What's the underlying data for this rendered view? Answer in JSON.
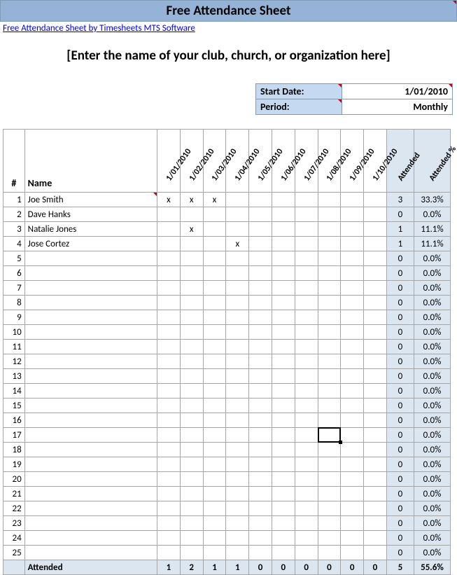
{
  "title": "Free Attendance Sheet",
  "linktext": "Free Attendance Sheet by Timesheets MTS Software",
  "organization": "[Enter the name of your club, church, or organization here]",
  "config": {
    "start_label": "Start Date:",
    "start_value": "1/01/2010",
    "period_label": "Period:",
    "period_value": "Monthly"
  },
  "headers": {
    "num": "#",
    "name": "Name",
    "dates": [
      "1/01/2010",
      "1/02/2010",
      "1/03/2010",
      "1/04/2010",
      "1/05/2010",
      "1/06/2010",
      "1/07/2010",
      "1/08/2010",
      "1/09/2010",
      "1/10/2010"
    ],
    "attended": "Attended",
    "attended_pct": "Attended %"
  },
  "rows": [
    {
      "num": 1,
      "name": "Joe Smith",
      "marks": [
        "x",
        "x",
        "x",
        "",
        "",
        "",
        "",
        "",
        "",
        ""
      ],
      "att": 3,
      "pct": "33.3%"
    },
    {
      "num": 2,
      "name": "Dave Hanks",
      "marks": [
        "",
        "",
        "",
        "",
        "",
        "",
        "",
        "",
        "",
        ""
      ],
      "att": 0,
      "pct": "0.0%"
    },
    {
      "num": 3,
      "name": "Natalie Jones",
      "marks": [
        "",
        "x",
        "",
        "",
        "",
        "",
        "",
        "",
        "",
        ""
      ],
      "att": 1,
      "pct": "11.1%"
    },
    {
      "num": 4,
      "name": "Jose Cortez",
      "marks": [
        "",
        "",
        "",
        "x",
        "",
        "",
        "",
        "",
        "",
        ""
      ],
      "att": 1,
      "pct": "11.1%"
    },
    {
      "num": 5,
      "name": "",
      "marks": [
        "",
        "",
        "",
        "",
        "",
        "",
        "",
        "",
        "",
        ""
      ],
      "att": 0,
      "pct": "0.0%"
    },
    {
      "num": 6,
      "name": "",
      "marks": [
        "",
        "",
        "",
        "",
        "",
        "",
        "",
        "",
        "",
        ""
      ],
      "att": 0,
      "pct": "0.0%"
    },
    {
      "num": 7,
      "name": "",
      "marks": [
        "",
        "",
        "",
        "",
        "",
        "",
        "",
        "",
        "",
        ""
      ],
      "att": 0,
      "pct": "0.0%"
    },
    {
      "num": 8,
      "name": "",
      "marks": [
        "",
        "",
        "",
        "",
        "",
        "",
        "",
        "",
        "",
        ""
      ],
      "att": 0,
      "pct": "0.0%"
    },
    {
      "num": 9,
      "name": "",
      "marks": [
        "",
        "",
        "",
        "",
        "",
        "",
        "",
        "",
        "",
        ""
      ],
      "att": 0,
      "pct": "0.0%"
    },
    {
      "num": 10,
      "name": "",
      "marks": [
        "",
        "",
        "",
        "",
        "",
        "",
        "",
        "",
        "",
        ""
      ],
      "att": 0,
      "pct": "0.0%"
    },
    {
      "num": 11,
      "name": "",
      "marks": [
        "",
        "",
        "",
        "",
        "",
        "",
        "",
        "",
        "",
        ""
      ],
      "att": 0,
      "pct": "0.0%"
    },
    {
      "num": 12,
      "name": "",
      "marks": [
        "",
        "",
        "",
        "",
        "",
        "",
        "",
        "",
        "",
        ""
      ],
      "att": 0,
      "pct": "0.0%"
    },
    {
      "num": 13,
      "name": "",
      "marks": [
        "",
        "",
        "",
        "",
        "",
        "",
        "",
        "",
        "",
        ""
      ],
      "att": 0,
      "pct": "0.0%"
    },
    {
      "num": 14,
      "name": "",
      "marks": [
        "",
        "",
        "",
        "",
        "",
        "",
        "",
        "",
        "",
        ""
      ],
      "att": 0,
      "pct": "0.0%"
    },
    {
      "num": 15,
      "name": "",
      "marks": [
        "",
        "",
        "",
        "",
        "",
        "",
        "",
        "",
        "",
        ""
      ],
      "att": 0,
      "pct": "0.0%"
    },
    {
      "num": 16,
      "name": "",
      "marks": [
        "",
        "",
        "",
        "",
        "",
        "",
        "",
        "",
        "",
        ""
      ],
      "att": 0,
      "pct": "0.0%"
    },
    {
      "num": 17,
      "name": "",
      "marks": [
        "",
        "",
        "",
        "",
        "",
        "",
        "",
        "",
        "",
        ""
      ],
      "att": 0,
      "pct": "0.0%"
    },
    {
      "num": 18,
      "name": "",
      "marks": [
        "",
        "",
        "",
        "",
        "",
        "",
        "",
        "",
        "",
        ""
      ],
      "att": 0,
      "pct": "0.0%"
    },
    {
      "num": 19,
      "name": "",
      "marks": [
        "",
        "",
        "",
        "",
        "",
        "",
        "",
        "",
        "",
        ""
      ],
      "att": 0,
      "pct": "0.0%"
    },
    {
      "num": 20,
      "name": "",
      "marks": [
        "",
        "",
        "",
        "",
        "",
        "",
        "",
        "",
        "",
        ""
      ],
      "att": 0,
      "pct": "0.0%"
    },
    {
      "num": 21,
      "name": "",
      "marks": [
        "",
        "",
        "",
        "",
        "",
        "",
        "",
        "",
        "",
        ""
      ],
      "att": 0,
      "pct": "0.0%"
    },
    {
      "num": 22,
      "name": "",
      "marks": [
        "",
        "",
        "",
        "",
        "",
        "",
        "",
        "",
        "",
        ""
      ],
      "att": 0,
      "pct": "0.0%"
    },
    {
      "num": 23,
      "name": "",
      "marks": [
        "",
        "",
        "",
        "",
        "",
        "",
        "",
        "",
        "",
        ""
      ],
      "att": 0,
      "pct": "0.0%"
    },
    {
      "num": 24,
      "name": "",
      "marks": [
        "",
        "",
        "",
        "",
        "",
        "",
        "",
        "",
        "",
        ""
      ],
      "att": 0,
      "pct": "0.0%"
    },
    {
      "num": 25,
      "name": "",
      "marks": [
        "",
        "",
        "",
        "",
        "",
        "",
        "",
        "",
        "",
        ""
      ],
      "att": 0,
      "pct": "0.0%"
    }
  ],
  "totals": {
    "label": "Attended",
    "cols": [
      1,
      2,
      1,
      1,
      0,
      0,
      0,
      0,
      0,
      0
    ],
    "sum": 5,
    "pct": "55.6%"
  },
  "cursor": {
    "row": 17,
    "col": 8
  }
}
